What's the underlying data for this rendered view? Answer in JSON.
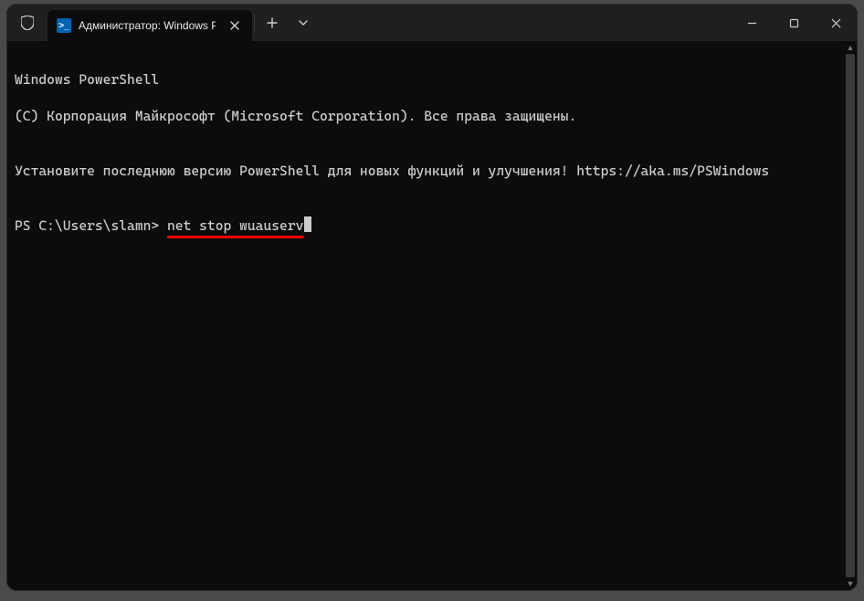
{
  "window": {
    "tab": {
      "icon_text": ">_",
      "title": "Администратор: Windows Po"
    },
    "controls": {
      "minimize": "minimize",
      "maximize": "maximize",
      "close": "close"
    }
  },
  "terminal": {
    "line1": "Windows PowerShell",
    "line2": "(C) Корпорация Майкрософт (Microsoft Corporation). Все права защищены.",
    "blank1": "",
    "line3": "Установите последнюю версию PowerShell для новых функций и улучшения! https://aka.ms/PSWindows",
    "blank2": "",
    "prompt": "PS C:\\Users\\slamn> ",
    "command": "net stop wuauserv"
  },
  "colors": {
    "bg": "#0c0c0c",
    "titlebar": "#1f1f1f",
    "text": "#cccccc",
    "underline": "#ff0000",
    "ps_icon_bg": "#0063b1"
  }
}
